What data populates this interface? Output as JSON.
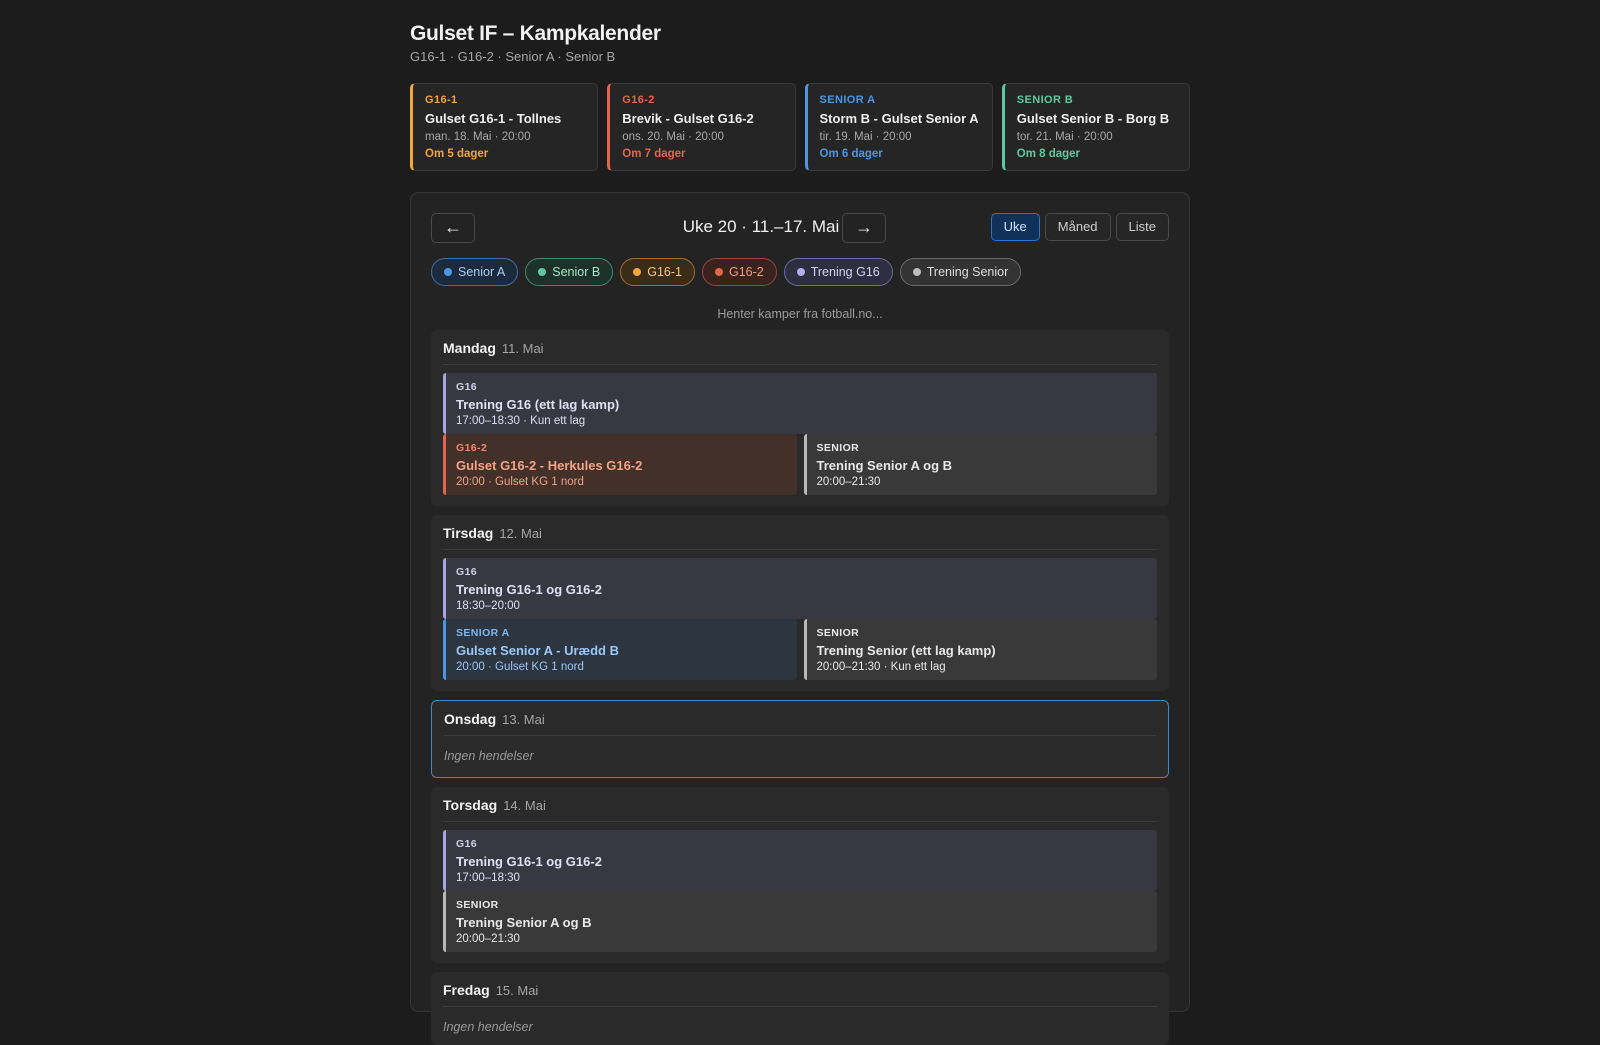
{
  "header": {
    "title": "Gulset IF – Kampkalender",
    "subtitle": "G16-1 · G16-2 · Senior A · Senior B"
  },
  "upcoming": [
    {
      "label": "G16-1",
      "match": "Gulset G16-1 - Tollnes",
      "date": "man. 18. Mai · 20:00",
      "countdown": "Om 5 dager",
      "color": "#f2a53a"
    },
    {
      "label": "G16-2",
      "match": "Brevik - Gulset G16-2",
      "date": "ons. 20. Mai · 20:00",
      "countdown": "Om 7 dager",
      "color": "#e0674c"
    },
    {
      "label": "SENIOR A",
      "match": "Storm B - Gulset Senior A",
      "date": "tir. 19. Mai · 20:00",
      "countdown": "Om 6 dager",
      "color": "#4c97e3"
    },
    {
      "label": "SENIOR B",
      "match": "Gulset Senior B - Borg B",
      "date": "tor. 21. Mai · 20:00",
      "countdown": "Om 8 dager",
      "color": "#5ec9a0"
    }
  ],
  "nav": {
    "prev_icon": "←",
    "next_icon": "→",
    "week_title": "Uke 20 · 11.–17. Mai",
    "views": [
      "Uke",
      "Måned",
      "Liste"
    ],
    "active_view": "Uke"
  },
  "filters": [
    {
      "label": "Senior A",
      "color": "#4c97e3",
      "bg": "#1b2b3d",
      "border": "#3d6ea3",
      "text": "#a9cdf5"
    },
    {
      "label": "Senior B",
      "color": "#5ec9a0",
      "bg": "#1c3129",
      "border": "#3f8a6c",
      "text": "#a6e6cb"
    },
    {
      "label": "G16-1",
      "color": "#f2a53a",
      "bg": "#3a2c18",
      "border": "#a06f2b",
      "text": "#f6c67f"
    },
    {
      "label": "G16-2",
      "color": "#e0674c",
      "bg": "#3a231c",
      "border": "#94473a",
      "text": "#f19b82"
    },
    {
      "label": "Trening G16",
      "color": "#b3aee8",
      "bg": "#2f2d40",
      "border": "#6e6a99",
      "text": "#d4d1f3"
    },
    {
      "label": "Trening Senior",
      "color": "#bdbdbd",
      "bg": "#333333",
      "border": "#6b6b6b",
      "text": "#dedede"
    }
  ],
  "loading_text": "Henter kamper fra fotball.no...",
  "days": {
    "mon": {
      "name": "Mandag",
      "date": "11. Mai",
      "ev1": {
        "label": "G16",
        "title": "Trening G16 (ett lag kamp)",
        "meta": "17:00–18:30 · Kun ett lag"
      },
      "ev2": {
        "label": "G16-2",
        "title": "Gulset G16-2 - Herkules G16-2",
        "meta": "20:00 · Gulset KG 1 nord"
      },
      "ev3": {
        "label": "SENIOR",
        "title": "Trening Senior A og B",
        "meta": "20:00–21:30"
      }
    },
    "tue": {
      "name": "Tirsdag",
      "date": "12. Mai",
      "ev1": {
        "label": "G16",
        "title": "Trening G16-1 og G16-2",
        "meta": "18:30–20:00"
      },
      "ev2": {
        "label": "SENIOR A",
        "title": "Gulset Senior A - Urædd B",
        "meta": "20:00 · Gulset KG 1 nord"
      },
      "ev3": {
        "label": "SENIOR",
        "title": "Trening Senior (ett lag kamp)",
        "meta": "20:00–21:30 · Kun ett lag"
      }
    },
    "wed": {
      "name": "Onsdag",
      "date": "13. Mai",
      "empty": "Ingen hendelser"
    },
    "thu": {
      "name": "Torsdag",
      "date": "14. Mai",
      "ev1": {
        "label": "G16",
        "title": "Trening G16-1 og G16-2",
        "meta": "17:00–18:30"
      },
      "ev2": {
        "label": "SENIOR",
        "title": "Trening Senior A og B",
        "meta": "20:00–21:30"
      }
    },
    "fri": {
      "name": "Fredag",
      "date": "15. Mai",
      "empty": "Ingen hendelser"
    }
  }
}
